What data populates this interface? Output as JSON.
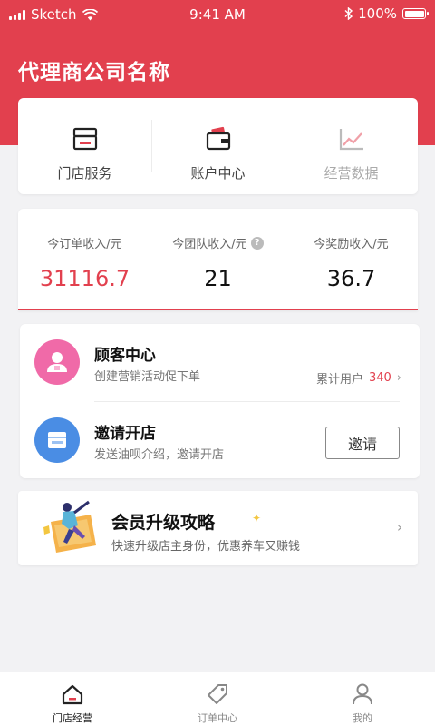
{
  "status_bar": {
    "carrier": "Sketch",
    "time": "9:41 AM",
    "battery": "100%"
  },
  "header": {
    "title": "代理商公司名称",
    "background_color": "#e2404e"
  },
  "quick_nav": [
    {
      "label": "门店服务",
      "icon": "store-icon"
    },
    {
      "label": "账户中心",
      "icon": "wallet-icon"
    },
    {
      "label": "经营数据",
      "icon": "chart-icon"
    }
  ],
  "stats": [
    {
      "label": "今订单收入/元",
      "value": "31116.7"
    },
    {
      "label": "今团队收入/元",
      "value": "21",
      "help": "?"
    },
    {
      "label": "今奖励收入/元",
      "value": "36.7"
    }
  ],
  "customer_center": {
    "title": "顾客中心",
    "subtitle": "创建营销活动促下单",
    "meta_label": "累计用户",
    "meta_value": "340",
    "chevron": "›"
  },
  "invite_store": {
    "title": "邀请开店",
    "subtitle": "发送油呗介绍，邀请开店",
    "button_label": "邀请"
  },
  "promo": {
    "title": "会员升级攻略",
    "subtitle": "快速升级店主身份，优惠养车又赚钱",
    "chevron": "›"
  },
  "tabs": [
    {
      "label": "门店经营",
      "icon": "store-tab-icon",
      "active": true
    },
    {
      "label": "订单中心",
      "icon": "tag-icon",
      "active": false
    },
    {
      "label": "我的",
      "icon": "user-icon",
      "active": false
    }
  ],
  "colors": {
    "accent": "#e2404e",
    "pink": "#f06aa8",
    "blue": "#4a8de4"
  }
}
